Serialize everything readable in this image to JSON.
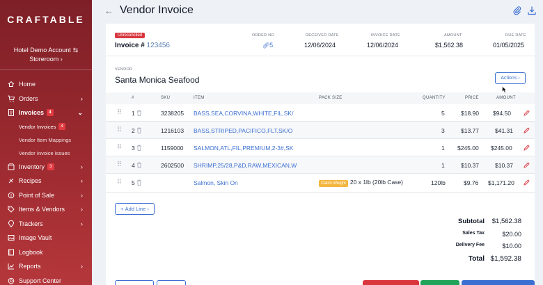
{
  "sidebar": {
    "logo": "CRAFTABLE",
    "account_name": "Hotel Demo Account",
    "account_sub": "Storeroom",
    "items": [
      {
        "label": "Home",
        "icon": "home-icon"
      },
      {
        "label": "Orders",
        "icon": "cart-icon"
      },
      {
        "label": "Invoices",
        "icon": "invoice-icon",
        "badge": "4"
      },
      {
        "label": "Inventory",
        "icon": "box-icon",
        "badge": "3"
      },
      {
        "label": "Recipes",
        "icon": "recipe-icon"
      },
      {
        "label": "Point of Sale",
        "icon": "pos-icon"
      },
      {
        "label": "Items & Vendors",
        "icon": "tag-icon"
      },
      {
        "label": "Trackers",
        "icon": "pin-icon"
      },
      {
        "label": "Image Vault",
        "icon": "image-icon"
      },
      {
        "label": "Logbook",
        "icon": "book-icon"
      },
      {
        "label": "Reports",
        "icon": "chart-icon"
      },
      {
        "label": "Support Center",
        "icon": "support-icon"
      }
    ],
    "sub_items": [
      {
        "label": "Vendor Invoices",
        "badge": "4"
      },
      {
        "label": "Vendor Item Mappings"
      },
      {
        "label": "Vendor Invoice Issues"
      }
    ]
  },
  "header": {
    "title": "Vendor Invoice"
  },
  "summary": {
    "status": "Unreconciled",
    "invoice_label": "Invoice #",
    "invoice_number": "123456",
    "order_no_label": "ORDER NO",
    "order_no": "5",
    "received_label": "RECEIVED DATE",
    "received": "12/06/2024",
    "invoice_date_label": "INVOICE DATE",
    "invoice_date": "12/06/2024",
    "amount_label": "AMOUNT",
    "amount": "$1,562.38",
    "due_label": "DUE DATE",
    "due": "01/05/2025"
  },
  "vendor": {
    "label": "VENDOR",
    "name": "Santa Monica Seafood",
    "actions": "Actions"
  },
  "table": {
    "headers": {
      "num": "#",
      "sku": "SKU",
      "item": "ITEM",
      "pack": "PACK SIZE",
      "qty": "QUANTITY",
      "price": "PRICE",
      "amount": "AMOUNT"
    },
    "rows": [
      {
        "num": "1",
        "sku": "3238205",
        "item": "BASS,SEA,CORVINA,WHITE,FIL,SK/",
        "pack": "",
        "tag": "",
        "qty": "5",
        "price": "$18.90",
        "amount": "$94.50"
      },
      {
        "num": "2",
        "sku": "1216103",
        "item": "BASS,STRIPED,PACIFICO,FLT,SK/O",
        "pack": "",
        "tag": "",
        "qty": "3",
        "price": "$13.77",
        "amount": "$41.31"
      },
      {
        "num": "3",
        "sku": "1159000",
        "item": "SALMON,ATL,FIL,PREMIUM,2-3#,SK",
        "pack": "",
        "tag": "",
        "qty": "1",
        "price": "$245.00",
        "amount": "$245.00"
      },
      {
        "num": "4",
        "sku": "2602500",
        "item": "SHRIMP,25/28,P&D,RAW,MEXICAN,W",
        "pack": "",
        "tag": "",
        "qty": "1",
        "price": "$10.37",
        "amount": "$10.37"
      },
      {
        "num": "5",
        "sku": "",
        "item": "Salmon, Skin On",
        "pack": "20 x 1lb (20lb Case)",
        "tag": "Catch Weight",
        "qty": "120lb",
        "price": "$9.76",
        "amount": "$1,171.20"
      }
    ],
    "add_line": "Add Line"
  },
  "totals": {
    "subtotal_label": "Subtotal",
    "subtotal": "$1,562.38",
    "tax_label": "Sales Tax",
    "tax": "$20.00",
    "delivery_label": "Delivery Fee",
    "delivery": "$10.00",
    "total_label": "Total",
    "total": "$1,592.38"
  },
  "colors": {
    "sidebar": "#8f262d",
    "accent": "#3b6fd1",
    "status": "#d9363e",
    "catch_weight": "#f4b63f",
    "danger": "#d9363e",
    "success": "#22a35a"
  }
}
